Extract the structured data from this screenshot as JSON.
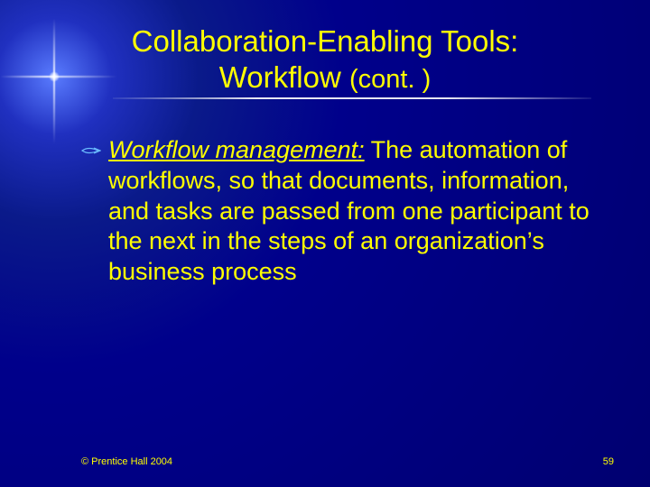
{
  "title_line1": "Collaboration-Enabling Tools:",
  "title_line2_a": "Workflow ",
  "title_line2_b": "(cont. )",
  "bullet_term": "Workflow management:",
  "bullet_rest": " The automation of workflows, so that documents, information, and tasks are passed from one participant to the next in the steps of an organization’s business process",
  "footer_left": "© Prentice Hall 2004",
  "footer_right": "59"
}
